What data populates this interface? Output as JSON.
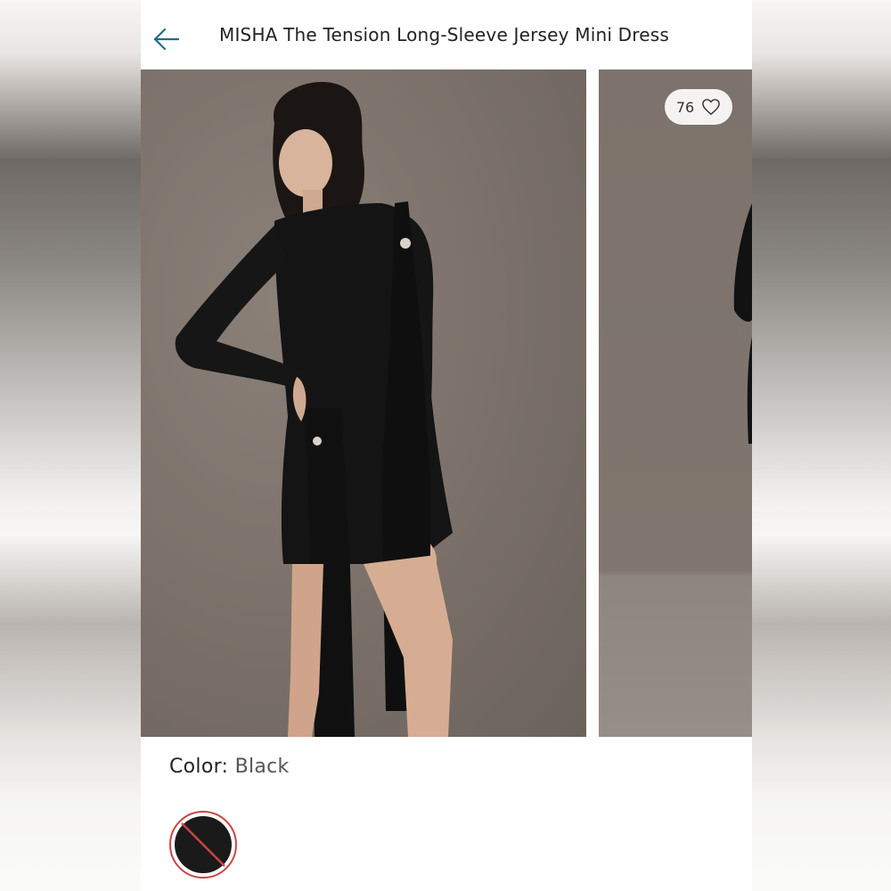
{
  "header": {
    "title": "MISHA The Tension Long-Sleeve Jersey Mini Dress",
    "back_icon": "arrow-left-icon"
  },
  "gallery": {
    "favorite_count": "76",
    "favorite_icon": "heart-icon"
  },
  "color": {
    "label": "Color:",
    "value": "Black",
    "swatch_color": "#1a1a1a",
    "swatch_status": "unavailable"
  },
  "colors": {
    "accent": "#1f6f8b",
    "photo_background": "#7a7069",
    "dress": "#141414"
  }
}
